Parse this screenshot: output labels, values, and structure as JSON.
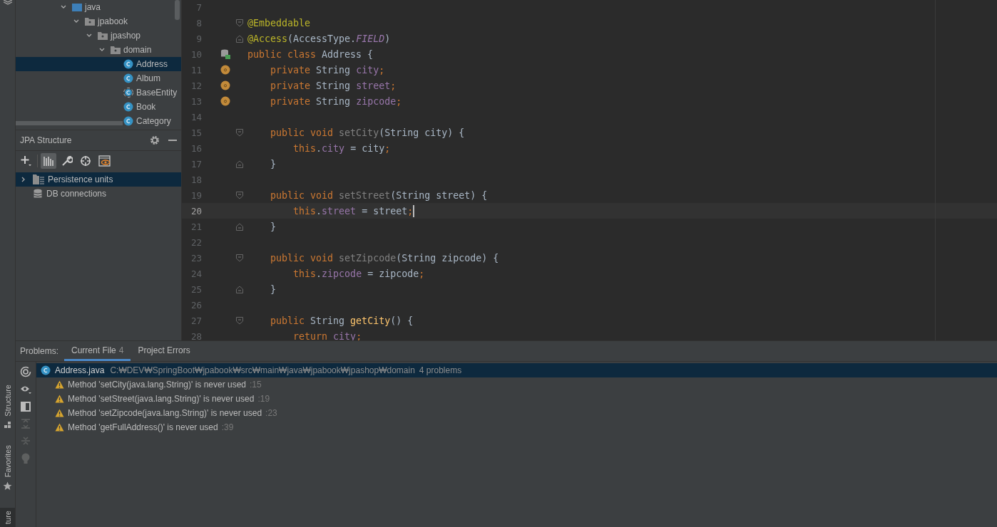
{
  "side_strip": {
    "tabs": [
      {
        "label": "Structure",
        "kind": "structure",
        "selected": false
      },
      {
        "label": "Favorites",
        "kind": "favorites",
        "selected": false
      },
      {
        "label": "ture",
        "kind": "plain",
        "selected": true
      }
    ]
  },
  "project_tree": {
    "items": [
      {
        "label": "java",
        "kind": "source",
        "expanded": true,
        "selected": false,
        "children": [
          {
            "label": "jpabook",
            "kind": "package",
            "expanded": true,
            "selected": false,
            "children": [
              {
                "label": "jpashop",
                "kind": "package",
                "expanded": true,
                "selected": false,
                "children": [
                  {
                    "label": "domain",
                    "kind": "package",
                    "expanded": true,
                    "selected": false,
                    "children": [
                      {
                        "label": "Address",
                        "kind": "class",
                        "selected": true
                      },
                      {
                        "label": "Album",
                        "kind": "class",
                        "selected": false
                      },
                      {
                        "label": "BaseEntity",
                        "kind": "abstract",
                        "selected": false
                      },
                      {
                        "label": "Book",
                        "kind": "class",
                        "selected": false
                      },
                      {
                        "label": "Category",
                        "kind": "class",
                        "selected": false
                      }
                    ]
                  }
                ]
              }
            ]
          }
        ]
      }
    ]
  },
  "jpa_structure": {
    "title": "JPA Structure",
    "tools": [
      {
        "kind": "add",
        "selected": false
      },
      {
        "kind": "bars",
        "selected": true
      },
      {
        "kind": "wrench",
        "selected": false
      },
      {
        "kind": "target",
        "selected": false
      },
      {
        "kind": "eye",
        "selected": false
      }
    ],
    "items": [
      {
        "label": "Persistence units",
        "kind": "units",
        "expanded": false,
        "selected": true
      },
      {
        "label": "DB connections",
        "kind": "db",
        "selected": false
      }
    ]
  },
  "editor": {
    "lines": [
      {
        "number": "7"
      },
      {
        "number": "8",
        "fold": {
          "kind": "start"
        },
        "tokens": [
          {
            "kind": "ann",
            "text": "@Embeddable"
          }
        ]
      },
      {
        "number": "9",
        "fold": {
          "kind": "end"
        },
        "tokens": [
          {
            "kind": "ann",
            "text": "@Access"
          },
          {
            "kind": "plain",
            "text": "(AccessType."
          },
          {
            "kind": "const",
            "text": "FIELD"
          },
          {
            "kind": "plain",
            "text": ")"
          }
        ]
      },
      {
        "number": "10",
        "gutter": {
          "kind": "entity"
        },
        "tokens": [
          {
            "kind": "kw",
            "text": "public class "
          },
          {
            "kind": "plain",
            "text": "Address {"
          }
        ]
      },
      {
        "number": "11",
        "gutter": {
          "kind": "field"
        },
        "tokens": [
          {
            "kind": "kw",
            "text": "    private "
          },
          {
            "kind": "plain",
            "text": "String "
          },
          {
            "kind": "field",
            "text": "city"
          },
          {
            "kind": "kw",
            "text": ";"
          }
        ]
      },
      {
        "number": "12",
        "gutter": {
          "kind": "field"
        },
        "tokens": [
          {
            "kind": "kw",
            "text": "    private "
          },
          {
            "kind": "plain",
            "text": "String "
          },
          {
            "kind": "field",
            "text": "street"
          },
          {
            "kind": "kw",
            "text": ";"
          }
        ]
      },
      {
        "number": "13",
        "gutter": {
          "kind": "field"
        },
        "tokens": [
          {
            "kind": "kw",
            "text": "    private "
          },
          {
            "kind": "plain",
            "text": "String "
          },
          {
            "kind": "field",
            "text": "zipcode"
          },
          {
            "kind": "kw",
            "text": ";"
          }
        ]
      },
      {
        "number": "14"
      },
      {
        "number": "15",
        "fold": {
          "kind": "start"
        },
        "tokens": [
          {
            "kind": "kw",
            "text": "    public void "
          },
          {
            "kind": "unused",
            "text": "setCity"
          },
          {
            "kind": "plain",
            "text": "(String city) {"
          }
        ]
      },
      {
        "number": "16",
        "tokens": [
          {
            "kind": "kw",
            "text": "        this"
          },
          {
            "kind": "plain",
            "text": "."
          },
          {
            "kind": "field",
            "text": "city"
          },
          {
            "kind": "plain",
            "text": " = city"
          },
          {
            "kind": "kw",
            "text": ";"
          }
        ]
      },
      {
        "number": "17",
        "fold": {
          "kind": "end"
        },
        "tokens": [
          {
            "kind": "plain",
            "text": "    }"
          }
        ]
      },
      {
        "number": "18"
      },
      {
        "number": "19",
        "fold": {
          "kind": "start"
        },
        "tokens": [
          {
            "kind": "kw",
            "text": "    public void "
          },
          {
            "kind": "unused",
            "text": "setStreet"
          },
          {
            "kind": "plain",
            "text": "(String street) {"
          }
        ]
      },
      {
        "number": "20",
        "current": true,
        "tokens": [
          {
            "kind": "kw",
            "text": "        this"
          },
          {
            "kind": "plain",
            "text": "."
          },
          {
            "kind": "field",
            "text": "street"
          },
          {
            "kind": "plain",
            "text": " = street"
          },
          {
            "kind": "kw",
            "text": ";"
          }
        ]
      },
      {
        "number": "21",
        "fold": {
          "kind": "end"
        },
        "tokens": [
          {
            "kind": "plain",
            "text": "    }"
          }
        ]
      },
      {
        "number": "22"
      },
      {
        "number": "23",
        "fold": {
          "kind": "start"
        },
        "tokens": [
          {
            "kind": "kw",
            "text": "    public void "
          },
          {
            "kind": "unused",
            "text": "setZipcode"
          },
          {
            "kind": "plain",
            "text": "(String zipcode) {"
          }
        ]
      },
      {
        "number": "24",
        "tokens": [
          {
            "kind": "kw",
            "text": "        this"
          },
          {
            "kind": "plain",
            "text": "."
          },
          {
            "kind": "field",
            "text": "zipcode"
          },
          {
            "kind": "plain",
            "text": " = zipcode"
          },
          {
            "kind": "kw",
            "text": ";"
          }
        ]
      },
      {
        "number": "25",
        "fold": {
          "kind": "end"
        },
        "tokens": [
          {
            "kind": "plain",
            "text": "    }"
          }
        ]
      },
      {
        "number": "26"
      },
      {
        "number": "27",
        "fold": {
          "kind": "start"
        },
        "tokens": [
          {
            "kind": "kw",
            "text": "    public "
          },
          {
            "kind": "plain",
            "text": "String "
          },
          {
            "kind": "method",
            "text": "getCity"
          },
          {
            "kind": "plain",
            "text": "() {"
          }
        ]
      },
      {
        "number": "28",
        "tokens": [
          {
            "kind": "kw",
            "text": "        return "
          },
          {
            "kind": "field",
            "text": "city"
          },
          {
            "kind": "kw",
            "text": ";"
          }
        ]
      }
    ]
  },
  "problems": {
    "label": "Problems:",
    "tabs": [
      {
        "label": "Current File",
        "count": "4",
        "selected": true
      },
      {
        "label": "Project Errors",
        "selected": false
      }
    ],
    "tools": [
      {
        "kind": "refresh"
      },
      {
        "kind": "eye"
      },
      {
        "kind": "panel"
      },
      {
        "kind": "expand"
      },
      {
        "kind": "collapse"
      },
      {
        "kind": "bulb"
      }
    ],
    "file": {
      "name": "Address.java",
      "path": "C:₩DEV₩SpringBoot₩jpabook₩src₩main₩java₩jpabook₩jpashop₩domain",
      "count": "4 problems",
      "selected": true
    },
    "items": [
      {
        "text": "Method 'setCity(java.lang.String)' is never used",
        "line": ":15"
      },
      {
        "text": "Method 'setStreet(java.lang.String)' is never used",
        "line": ":19"
      },
      {
        "text": "Method 'setZipcode(java.lang.String)' is never used",
        "line": ":23"
      },
      {
        "text": "Method 'getFullAddress()' is never used",
        "line": ":39"
      }
    ]
  }
}
